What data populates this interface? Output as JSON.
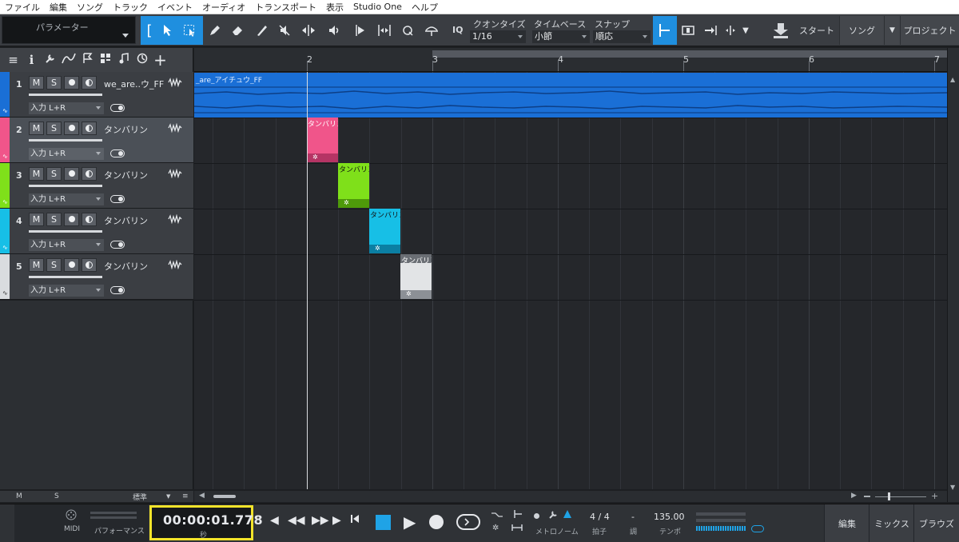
{
  "menu": [
    "ファイル",
    "編集",
    "ソング",
    "トラック",
    "イベント",
    "オーディオ",
    "トランスポート",
    "表示",
    "Studio One",
    "ヘルプ"
  ],
  "toolbar": {
    "parameter_label": "パラメーター",
    "iq_label": "IQ",
    "quantize_label": "クオンタイズ",
    "quantize_value": "1/16",
    "timebase_label": "タイムベース",
    "timebase_value": "小節",
    "snap_label": "スナップ",
    "snap_value": "順応",
    "start_label": "スタート",
    "song_label": "ソング",
    "project_label": "プロジェクト"
  },
  "ruler": {
    "bars": [
      "2",
      "3",
      "4",
      "5",
      "6",
      "7"
    ]
  },
  "tracks": [
    {
      "num": "1",
      "name": "we_are..ウ_FF",
      "input": "入力 L+R",
      "color": "#1a6fd6",
      "btn_m": "M",
      "btn_s": "S"
    },
    {
      "num": "2",
      "name": "タンバリン",
      "input": "入力 L+R",
      "color": "#f0558a",
      "btn_m": "M",
      "btn_s": "S"
    },
    {
      "num": "3",
      "name": "タンバリン",
      "input": "入力 L+R",
      "color": "#7fe01a",
      "btn_m": "M",
      "btn_s": "S"
    },
    {
      "num": "4",
      "name": "タンバリン",
      "input": "入力 L+R",
      "color": "#17bfe6",
      "btn_m": "M",
      "btn_s": "S"
    },
    {
      "num": "5",
      "name": "タンバリン",
      "input": "入力 L+R",
      "color": "#d9dcdf",
      "btn_m": "M",
      "btn_s": "S"
    }
  ],
  "events": {
    "audio_title": "_are_アイチュウ_FF",
    "clips": [
      {
        "title": "タンバリン",
        "color": "#f0558a",
        "dark": "#b53464"
      },
      {
        "title": "タンバリン",
        "color": "#7fe01a",
        "dark": "#4e9a0a"
      },
      {
        "title": "タンバリン",
        "color": "#17bfe6",
        "dark": "#0b7fa3"
      },
      {
        "title": "タンバリン",
        "color": "#e2e4e6",
        "dark": "#8c9096"
      }
    ]
  },
  "footer": {
    "m": "M",
    "s": "S",
    "view": "標準"
  },
  "transport": {
    "midi": "MIDI",
    "performance": "パフォーマンス",
    "time": "00:00:01.778",
    "time_unit": "秒",
    "metronome": "メトロノーム",
    "signature_value": "4 / 4",
    "signature_label": "拍子",
    "key_value": "-",
    "key_label": "調",
    "tempo_value": "135.00",
    "tempo_label": "テンポ",
    "edit": "編集",
    "mix": "ミックス",
    "browse": "ブラウズ"
  },
  "colors": {
    "accent": "#1f8fdf",
    "highlight_box": "#f2e32a"
  }
}
